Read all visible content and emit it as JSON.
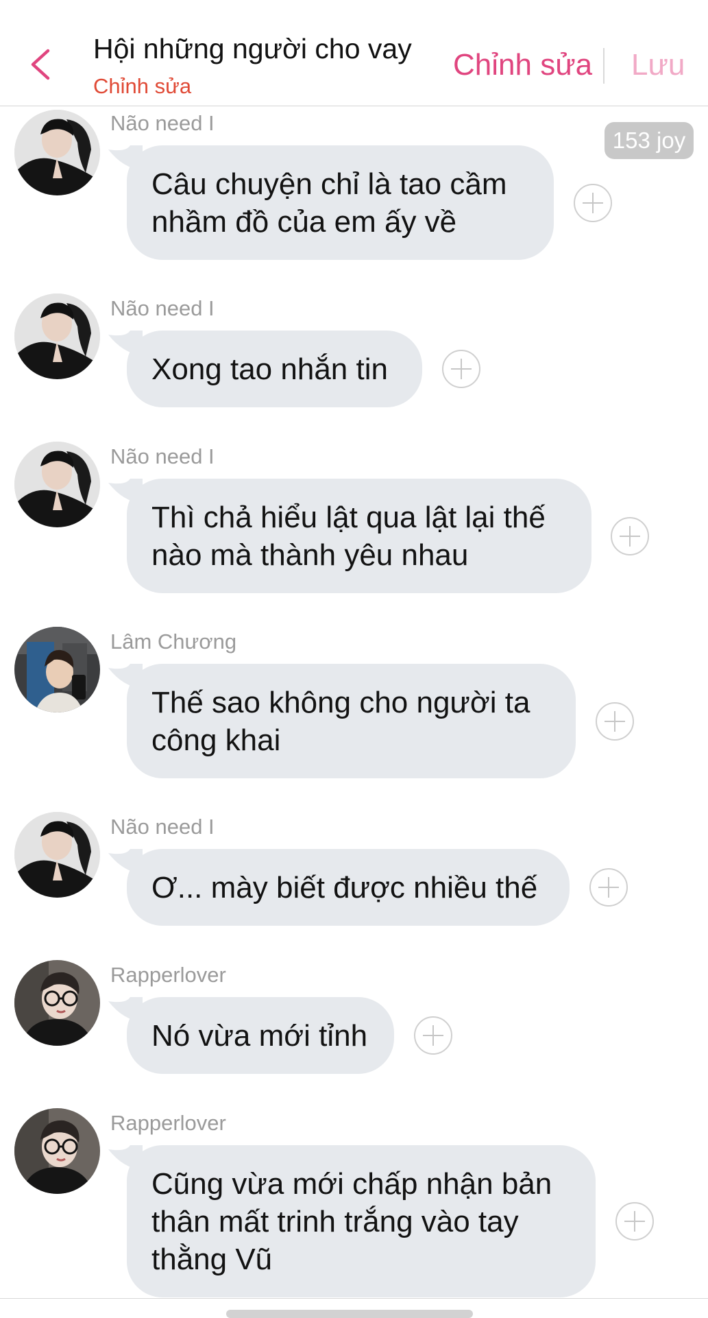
{
  "header": {
    "title": "Hội những người cho vay",
    "subtitle": "Chỉnh sửa",
    "edit_label": "Chỉnh sửa",
    "save_label": "Lưu",
    "back_icon": "chevron-left-icon",
    "accent_color": "#e0457f"
  },
  "badge": {
    "text": "153 joy"
  },
  "messages": [
    {
      "sender": "Não need I",
      "text": "Câu chuyện chỉ là tao cầm nhầm đồ của em ấy về",
      "avatar": "dark-portrait-avatar"
    },
    {
      "sender": "Não need I",
      "text": "Xong tao nhắn tin",
      "avatar": "dark-portrait-avatar"
    },
    {
      "sender": "Não need I",
      "text": "Thì chả hiểu lật qua lật lại thế nào mà thành yêu nhau",
      "avatar": "dark-portrait-avatar"
    },
    {
      "sender": "Lâm Chương",
      "text": "Thế sao không cho người ta công khai",
      "avatar": "selfie-avatar"
    },
    {
      "sender": "Não need I",
      "text": "Ơ... mày biết được nhiều thế",
      "avatar": "dark-portrait-avatar"
    },
    {
      "sender": "Rapperlover",
      "text": "Nó vừa mới tỉnh",
      "avatar": "glasses-avatar"
    },
    {
      "sender": "Rapperlover",
      "text": "Cũng vừa mới chấp nhận bản thân mất trinh trắng vào tay thằng Vũ",
      "avatar": "glasses-avatar"
    }
  ],
  "colors": {
    "bubble": "#e6e9ed",
    "subtitle": "#e04a36",
    "save": "#f1a9c6"
  }
}
